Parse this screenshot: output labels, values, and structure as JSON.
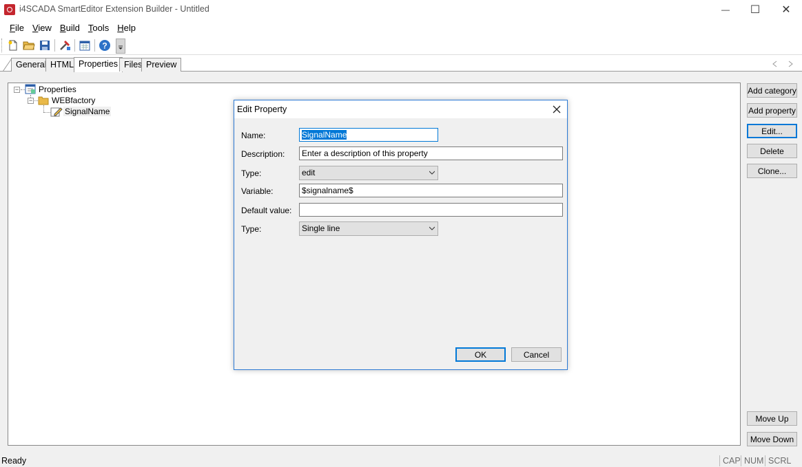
{
  "window": {
    "title": "i4SCADA SmartEditor Extension Builder - Untitled",
    "minimize_glyph": "—",
    "maximize_glyph": "☐",
    "close_glyph": "✕"
  },
  "menu": [
    {
      "prefix": "",
      "underlined": "F",
      "rest": "ile"
    },
    {
      "prefix": "",
      "underlined": "V",
      "rest": "iew"
    },
    {
      "prefix": "",
      "underlined": "B",
      "rest": "uild"
    },
    {
      "prefix": "",
      "underlined": "T",
      "rest": "ools"
    },
    {
      "prefix": "",
      "underlined": "H",
      "rest": "elp"
    }
  ],
  "toolbar_icons": [
    "new-file-icon",
    "open-folder-icon",
    "save-icon",
    "build-tools-icon",
    "calendar-icon",
    "help-icon",
    "overflow-icon"
  ],
  "tabs": [
    "General",
    "HTML",
    "Properties",
    "Files",
    "Preview"
  ],
  "active_tab": "Properties",
  "tree": {
    "root": "Properties",
    "category": "WEBfactory",
    "property": "SignalName"
  },
  "side_buttons": {
    "add_category": "Add category",
    "add_property": "Add property",
    "edit": "Edit...",
    "delete": "Delete",
    "clone": "Clone...",
    "move_up": "Move Up",
    "move_down": "Move Down"
  },
  "dialog": {
    "title": "Edit Property",
    "fields": {
      "name_label": "Name:",
      "name_value": "SignalName",
      "description_label": "Description:",
      "description_value": "Enter a description of this property",
      "type_label": "Type:",
      "type_value": "edit",
      "variable_label": "Variable:",
      "variable_value": "$signalname$",
      "default_label": "Default value:",
      "default_value": "",
      "type2_label": "Type:",
      "type2_value": "Single line"
    },
    "ok": "OK",
    "cancel": "Cancel"
  },
  "status": {
    "text": "Ready",
    "cap": "CAP",
    "num": "NUM",
    "scrl": "SCRL"
  },
  "colors": {
    "accent": "#0078d7",
    "app_icon": "#c4262e"
  }
}
